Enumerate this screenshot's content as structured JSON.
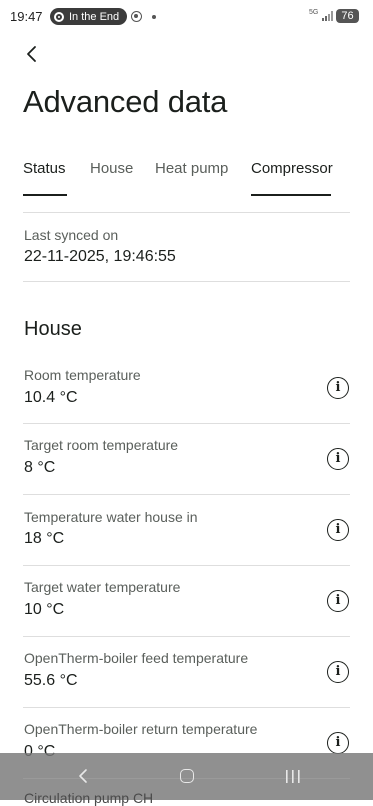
{
  "status_bar": {
    "time": "19:47",
    "media_pill": "In the End",
    "network": "5G",
    "battery": "76"
  },
  "header": {
    "title": "Advanced data"
  },
  "tabs": [
    {
      "label": "Status",
      "active": true
    },
    {
      "label": "House",
      "active": false
    },
    {
      "label": "Heat pump",
      "active": false
    },
    {
      "label": "Compressor",
      "active": false
    }
  ],
  "sync": {
    "label": "Last synced on",
    "value": "22-11-2025, 19:46:55"
  },
  "section": {
    "title": "House"
  },
  "rows": [
    {
      "label": "Room temperature",
      "value": "10.4 °C"
    },
    {
      "label": "Target room temperature",
      "value": "8 °C"
    },
    {
      "label": "Temperature water house in",
      "value": "18 °C"
    },
    {
      "label": "Target water temperature",
      "value": "10 °C"
    },
    {
      "label": "OpenTherm-boiler feed temperature",
      "value": "55.6 °C"
    },
    {
      "label": "OpenTherm-boiler return temperature",
      "value": "0 °C"
    }
  ],
  "peek_row": {
    "label": "Circulation pump CH"
  },
  "info_glyph": "i",
  "colors": {
    "text": "#1b1f1c",
    "muted": "#5a5f5b",
    "divider": "#dedede",
    "navbar": "#787878"
  }
}
